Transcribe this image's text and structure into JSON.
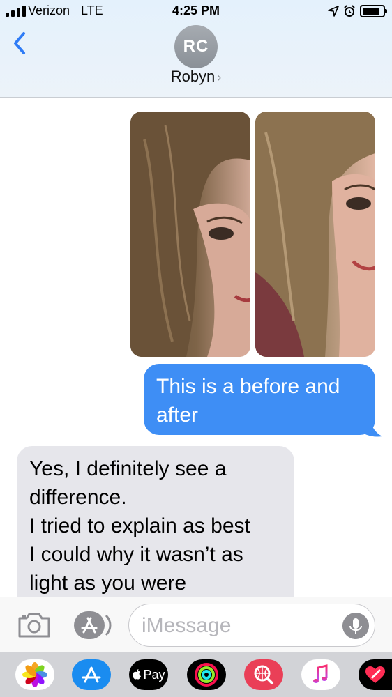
{
  "status_bar": {
    "carrier": "Verizon",
    "network": "LTE",
    "time": "4:25 PM",
    "battery_level": 0.85,
    "icons": [
      "signal-icon",
      "location-arrow-icon",
      "alarm-icon",
      "battery-icon"
    ]
  },
  "header": {
    "avatar_initials": "RC",
    "contact_name": "Robyn",
    "chevron": "›",
    "back_icon": "chevron-left-icon"
  },
  "messages": [
    {
      "type": "photos",
      "direction": "sent",
      "count": 2
    },
    {
      "type": "text",
      "direction": "sent",
      "lines": [
        "This is a before and",
        "after"
      ]
    },
    {
      "type": "text",
      "direction": "received",
      "lines": [
        "Yes, I definitely see a",
        "difference.",
        "I tried to explain as best",
        "I could why it wasn’t as",
        "light as you were"
      ]
    }
  ],
  "input_bar": {
    "placeholder": "iMessage",
    "camera_icon": "camera-icon",
    "apps_icon": "app-store-icon",
    "mic_icon": "microphone-icon"
  },
  "app_drawer": {
    "pay_label": "Pay",
    "apps": [
      "photos-icon",
      "app-store-icon",
      "apple-pay-icon",
      "activity-icon",
      "web-search-icon",
      "music-icon",
      "digital-touch-icon"
    ]
  },
  "colors": {
    "sent_bubble": "#3e8ef5",
    "received_bubble": "#e6e6eb",
    "accent": "#2f7cf6"
  }
}
